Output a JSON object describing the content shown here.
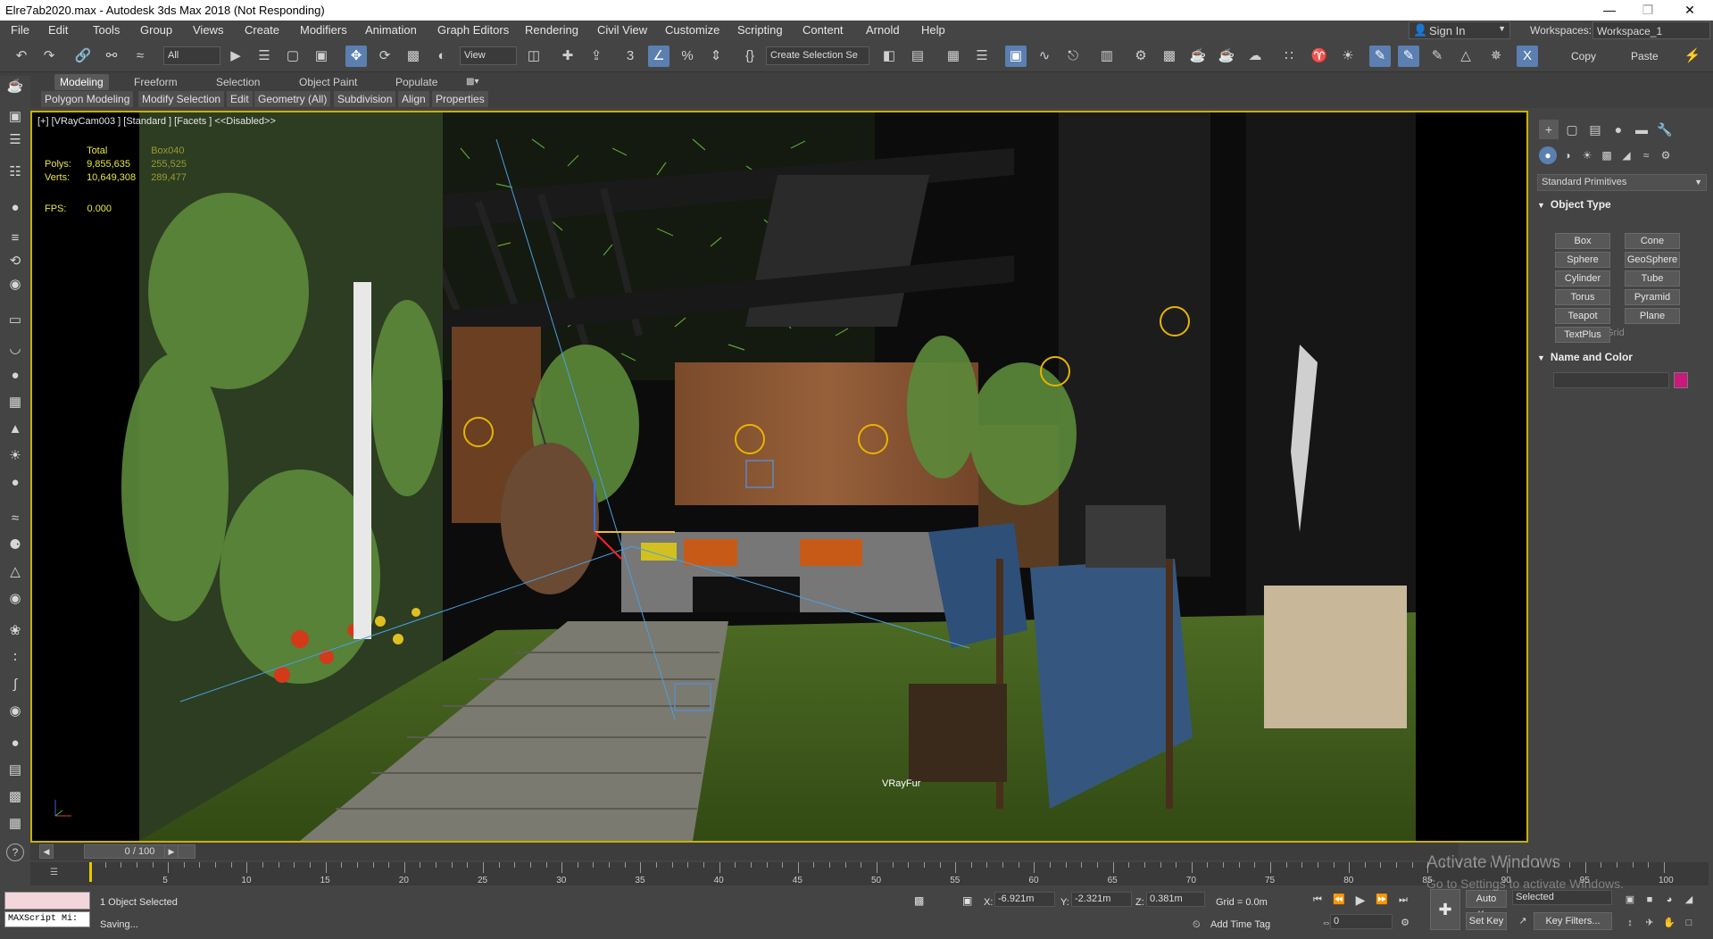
{
  "window": {
    "title": "Elre7ab2020.max - Autodesk 3ds Max 2018  (Not Responding)",
    "min_icon": "minimize-icon",
    "max_icon": "maximize-icon",
    "close_icon": "close-icon"
  },
  "menu": [
    "File",
    "Edit",
    "Tools",
    "Group",
    "Views",
    "Create",
    "Modifiers",
    "Animation",
    "Graph Editors",
    "Rendering",
    "Civil View",
    "Customize",
    "Scripting",
    "Content",
    "Arnold",
    "Help"
  ],
  "account": {
    "sign_in": "Sign In",
    "workspaces_label": "Workspaces:",
    "workspace": "Workspace_1"
  },
  "toolbar": {
    "filter": "All",
    "view": "View",
    "selection_set": "Create Selection Se",
    "copy": "Copy",
    "paste": "Paste"
  },
  "ribbon": {
    "tabs": [
      "Modeling",
      "Freeform",
      "Selection",
      "Object Paint",
      "Populate"
    ],
    "sub": [
      "Polygon Modeling",
      "Modify Selection",
      "Edit",
      "Geometry (All)",
      "Subdivision",
      "Align",
      "Properties"
    ]
  },
  "viewport": {
    "label": "[+] [VRayCam003 ] [Standard ] [Facets ]  <<Disabled>>",
    "stats": {
      "col1": [
        "",
        "Polys:",
        "Verts:"
      ],
      "col2": [
        "Total",
        "9,855,635",
        "10,649,308"
      ],
      "col3": [
        "Box040",
        "255,525",
        "289,477"
      ]
    },
    "fps_label": "FPS:",
    "fps_value": "0.000",
    "object_label": "VRayFur"
  },
  "command_panel": {
    "dropdown": "Standard Primitives",
    "object_type_title": "Object Type",
    "autogrid": "AutoGrid",
    "buttons": [
      "Box",
      "Cone",
      "Sphere",
      "GeoSphere",
      "Cylinder",
      "Tube",
      "Torus",
      "Pyramid",
      "Teapot",
      "Plane",
      "TextPlus"
    ],
    "name_color_title": "Name and Color",
    "swatch_color": "#c81a7c"
  },
  "timeline": {
    "frame": "0 / 100",
    "ticks": [
      "5",
      "10",
      "15",
      "20",
      "25",
      "30",
      "35",
      "40",
      "45",
      "50",
      "55",
      "60",
      "65",
      "70",
      "75",
      "80",
      "85",
      "90",
      "95",
      "100"
    ]
  },
  "status": {
    "maxscript": "MAXScript Mi:",
    "selected": "1 Object Selected",
    "saving": "Saving...",
    "x_label": "X:",
    "x": "-6.921m",
    "y_label": "Y:",
    "y": "-2.321m",
    "z_label": "Z:",
    "z": "0.381m",
    "grid": "Grid = 0.0m",
    "add_time_tag": "Add Time Tag",
    "auto_key": "Auto Key",
    "set_key": "Set Key",
    "key_mode": "Selected",
    "key_filters": "Key Filters...",
    "frame_field": "0"
  },
  "watermark": {
    "line1": "Activate Windows",
    "line2": "Go to Settings to activate Windows."
  }
}
